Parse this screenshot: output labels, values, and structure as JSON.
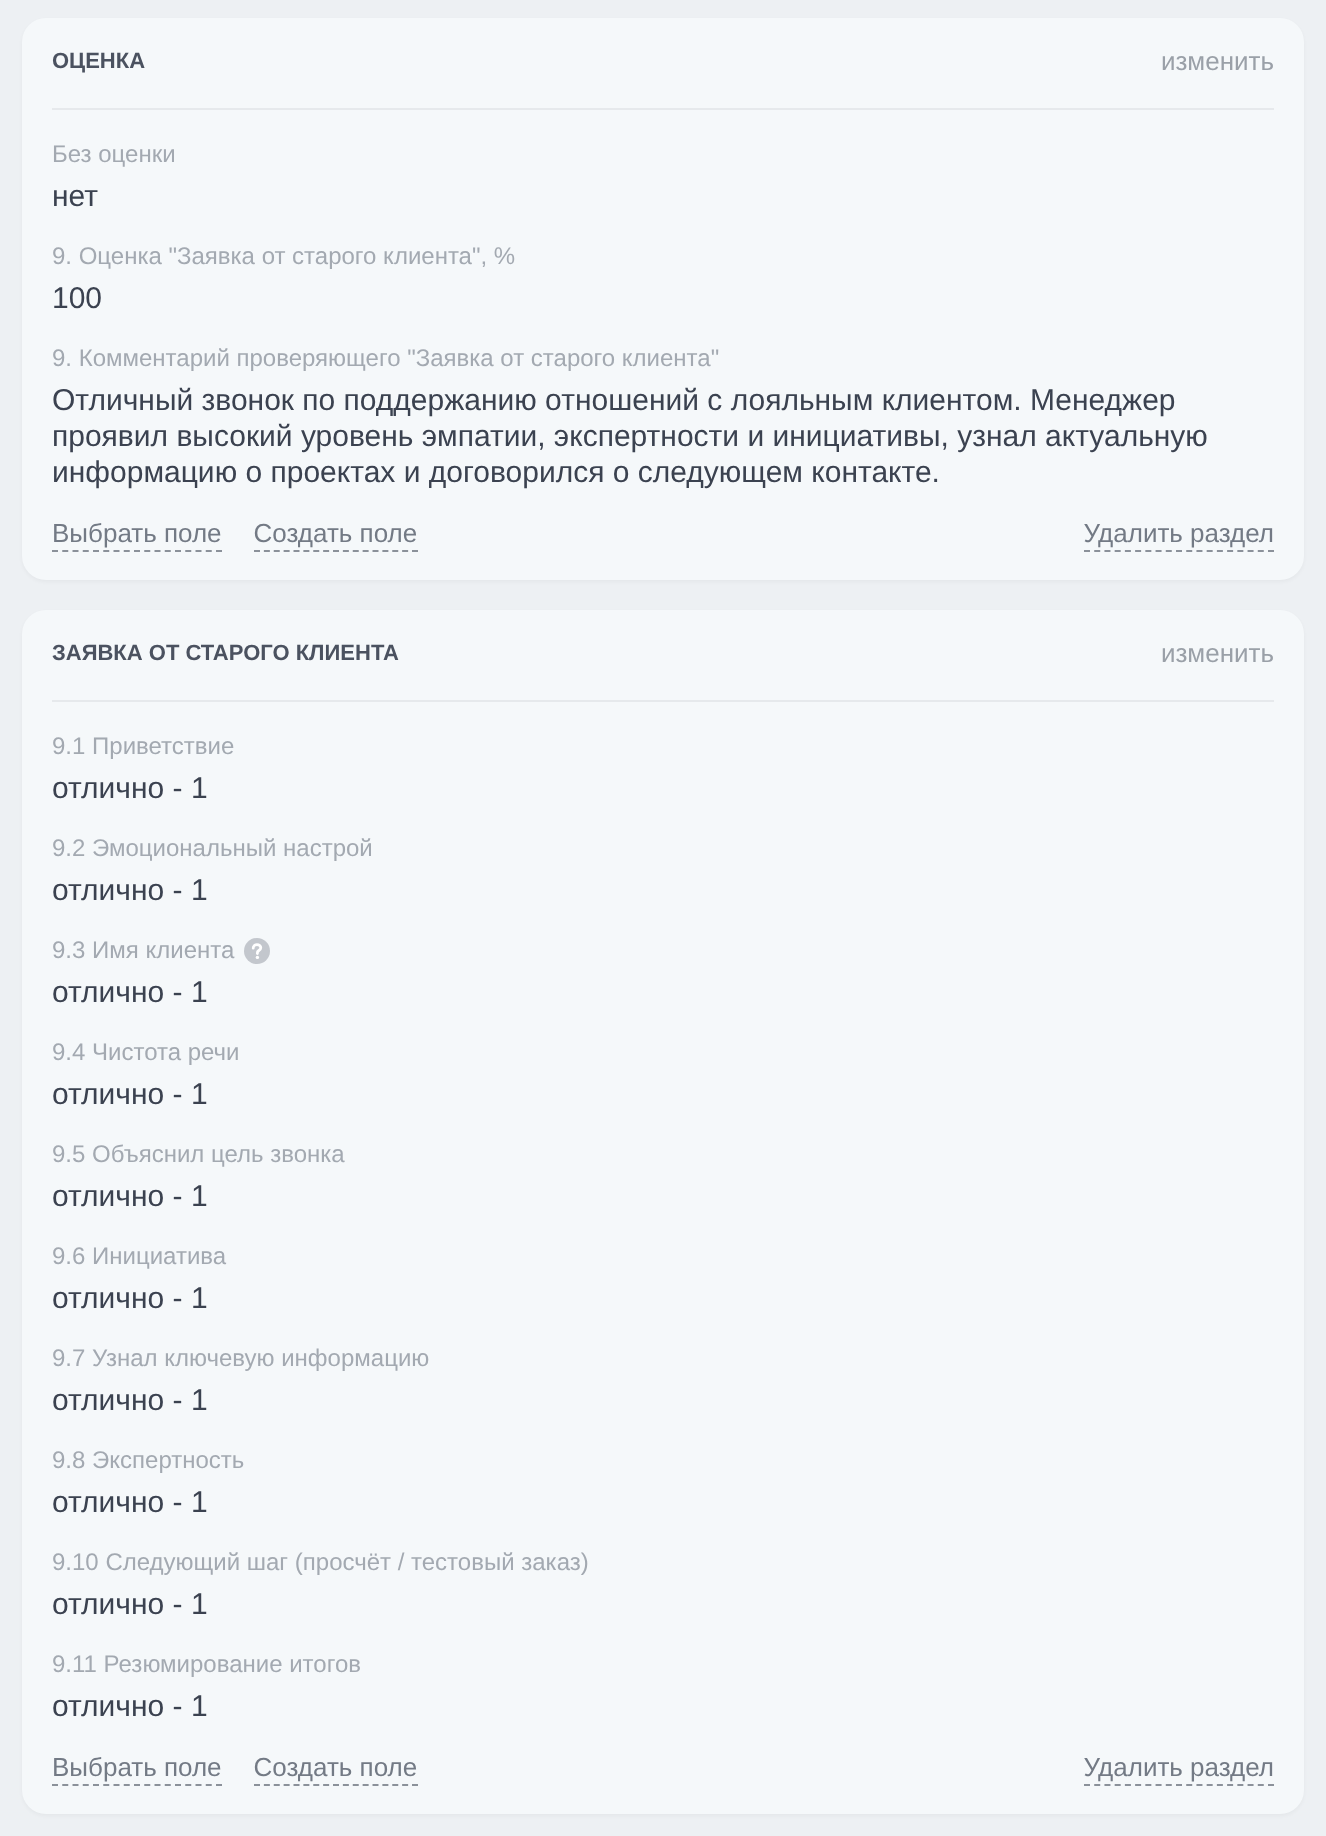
{
  "sections": [
    {
      "title": "ОЦЕНКА",
      "edit_link": "изменить",
      "fields": [
        {
          "label": "Без оценки",
          "value": "нет",
          "help": false
        },
        {
          "label": "9. Оценка \"Заявка от старого клиента\", %",
          "value": "100",
          "help": false
        },
        {
          "label": "9. Комментарий проверяющего \"Заявка от старого клиента\"",
          "value": "Отличный звонок по поддержанию отношений с лояльным клиентом. Менеджер проявил высокий уровень эмпатии, экспертности и инициативы, узнал актуальную информацию о проектах и договорился о следующем контакте.",
          "help": false
        }
      ],
      "footer": {
        "links": [
          "Выбрать поле",
          "Создать поле"
        ],
        "delete_link": "Удалить раздел"
      }
    },
    {
      "title": "ЗАЯВКА ОТ СТАРОГО КЛИЕНТА",
      "edit_link": "изменить",
      "fields": [
        {
          "label": "9.1 Приветствие",
          "value": "отлично - 1",
          "help": false
        },
        {
          "label": "9.2 Эмоциональный настрой",
          "value": "отлично - 1",
          "help": false
        },
        {
          "label": "9.3 Имя клиента",
          "value": "отлично - 1",
          "help": true
        },
        {
          "label": "9.4 Чистота речи",
          "value": "отлично - 1",
          "help": false
        },
        {
          "label": "9.5 Объяснил цель звонка",
          "value": "отлично - 1",
          "help": false
        },
        {
          "label": "9.6 Инициатива",
          "value": "отлично - 1",
          "help": false
        },
        {
          "label": "9.7 Узнал ключевую информацию",
          "value": "отлично - 1",
          "help": false
        },
        {
          "label": "9.8 Экспертность",
          "value": "отлично - 1",
          "help": false
        },
        {
          "label": "9.10 Следующий шаг (просчёт / тестовый заказ)",
          "value": "отлично - 1",
          "help": false
        },
        {
          "label": "9.11 Резюмирование итогов",
          "value": "отлично - 1",
          "help": false
        }
      ],
      "footer": {
        "links": [
          "Выбрать поле",
          "Создать поле"
        ],
        "delete_link": "Удалить раздел"
      }
    }
  ]
}
